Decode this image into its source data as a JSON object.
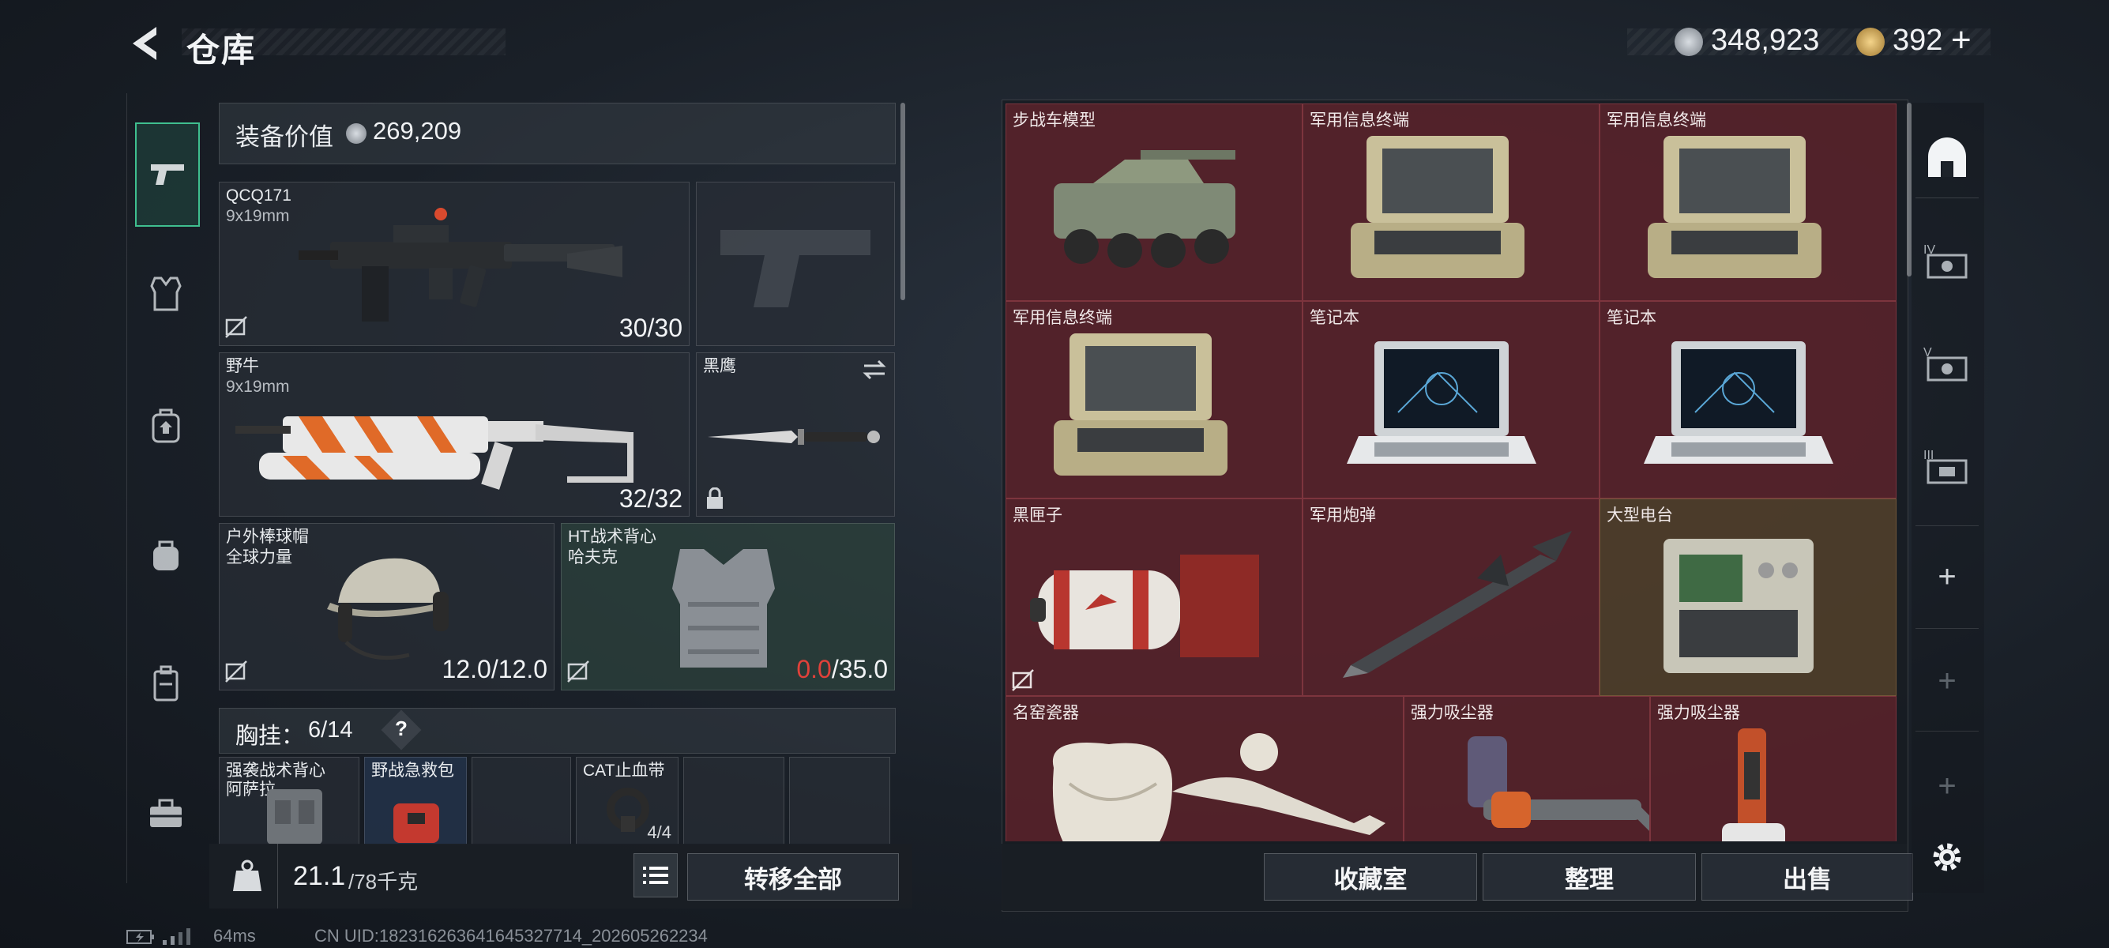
{
  "header": {
    "title": "仓库",
    "currency_coin": "348,923",
    "currency_premium": "392",
    "add_label": "+"
  },
  "sidebar": {
    "items": [
      {
        "name": "firearms",
        "icon": "pistol-icon",
        "active": true
      },
      {
        "name": "armor",
        "icon": "armor-vest-icon"
      },
      {
        "name": "backpack",
        "icon": "backpack-icon"
      },
      {
        "name": "bag",
        "icon": "bag-icon"
      },
      {
        "name": "container",
        "icon": "case-icon"
      },
      {
        "name": "toolbox",
        "icon": "toolbox-icon"
      }
    ]
  },
  "loadout": {
    "value_label": "装备价值",
    "value": "269,209",
    "primary": {
      "name": "QCQ171",
      "caliber": "9x19mm",
      "ammo": "30/30"
    },
    "secondary": {
      "name": "野牛",
      "caliber": "9x19mm",
      "ammo": "32/32"
    },
    "melee": {
      "name": "黑鹰"
    },
    "helmet": {
      "name": "户外棒球帽",
      "sub": "全球力量",
      "durability_cur": "12.0",
      "durability_max": "/12.0"
    },
    "armor": {
      "name": "HT战术背心",
      "sub": "哈夫克",
      "durability_cur": "0.0",
      "durability_max": "/35.0"
    },
    "rig": {
      "label": "胸挂：",
      "capacity": "6/14",
      "help": "?"
    },
    "rig_items": [
      {
        "name": "强袭战术背心",
        "sub": "阿萨拉"
      },
      {
        "name": "野战急救包",
        "sub": ""
      },
      {
        "name": "",
        "sub": ""
      },
      {
        "name": "CAT止血带",
        "sub": "",
        "count": "4/4"
      },
      {
        "name": "",
        "sub": ""
      },
      {
        "name": "",
        "sub": ""
      }
    ],
    "weight_current": "21.1",
    "weight_max": "/78千克",
    "transfer_all": "转移全部"
  },
  "stash": {
    "items": [
      {
        "label": "步战车模型",
        "art": "ifv",
        "tone": "red"
      },
      {
        "label": "军用信息终端",
        "art": "terminal",
        "tone": "red"
      },
      {
        "label": "军用信息终端",
        "art": "terminal",
        "tone": "red"
      },
      {
        "label": "军用信息终端",
        "art": "terminal",
        "tone": "red"
      },
      {
        "label": "笔记本",
        "art": "laptop",
        "tone": "red"
      },
      {
        "label": "笔记本",
        "art": "laptop",
        "tone": "red"
      },
      {
        "label": "黑匣子",
        "art": "blackbox",
        "tone": "red"
      },
      {
        "label": "军用炮弹",
        "art": "missile",
        "tone": "red"
      },
      {
        "label": "大型电台",
        "art": "radio",
        "tone": "gold"
      },
      {
        "label": "名窑瓷器",
        "art": "vase",
        "tone": "red"
      },
      {
        "label": "强力吸尘器",
        "art": "vacuum",
        "tone": "red"
      },
      {
        "label": "强力吸尘器",
        "art": "vacuum2",
        "tone": "red"
      }
    ],
    "buttons": {
      "collection": "收藏室",
      "sort": "整理",
      "sell": "出售"
    }
  },
  "right_tabs": [
    {
      "icon": "home-icon",
      "label": ""
    },
    {
      "icon": "tier-iv-case-icon",
      "label": "IV"
    },
    {
      "icon": "tier-v-case-icon",
      "label": "V"
    },
    {
      "icon": "tier-iii-case-icon",
      "label": "III"
    },
    {
      "icon": "plus-icon",
      "label": "+"
    },
    {
      "icon": "plus-icon",
      "label": "+"
    },
    {
      "icon": "plus-icon",
      "label": "+"
    }
  ],
  "footer": {
    "ping": "64ms",
    "uid": "CN UID:1823162636416453277​14_202605262234"
  },
  "colors": {
    "accent_green": "#3fbf8f",
    "stash_red": "#68242c",
    "durability_zero": "#e0413a"
  }
}
